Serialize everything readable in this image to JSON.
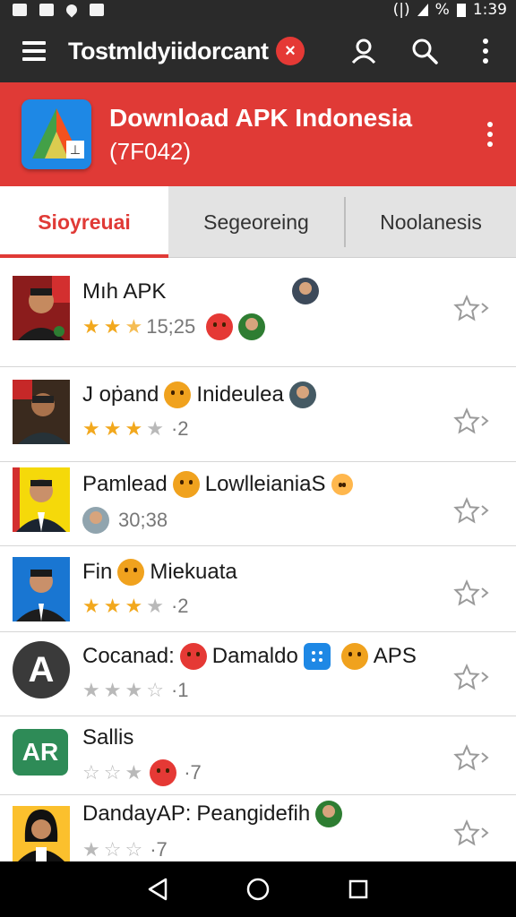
{
  "status_bar": {
    "time": "1:39",
    "battery": "%"
  },
  "app_bar": {
    "title": "Tostmldyiidorcant",
    "clear_icon": "×"
  },
  "header": {
    "title": "Download APK Indonesia",
    "subtitle": "(7F042)"
  },
  "tabs": [
    {
      "label": "Sioyreuai",
      "active": true
    },
    {
      "label": "Segeoreing",
      "active": false
    },
    {
      "label": "Noolanesis",
      "active": false
    }
  ],
  "apps": [
    {
      "title": "Mıh APK",
      "title_extra": "",
      "rating": 2.5,
      "meta": "15;25"
    },
    {
      "title": "J oṗand",
      "title_extra": "Inideulea",
      "rating": 3,
      "meta": "·2"
    },
    {
      "title": "Pamlead",
      "title_extra": "LowlleianiaS",
      "rating": 0,
      "meta": "30;38"
    },
    {
      "title": "Fin",
      "title_extra": "Miekuata",
      "rating": 3,
      "meta": "·2"
    },
    {
      "title": "Cocanad:",
      "title_extra": "Damaldo",
      "title_extra2": "APS",
      "rating": 0,
      "meta": "·1"
    },
    {
      "title": "Sallis",
      "title_extra": "",
      "rating": 0,
      "meta": "·7"
    },
    {
      "title": "DandayAP:",
      "title_extra": "Peangidefih",
      "rating": 0,
      "meta": "·7"
    }
  ],
  "thumb_text": {
    "app5": "A",
    "app6": "AR"
  },
  "colors": {
    "accent": "#e03a36",
    "star": "#f2a81d",
    "appbar": "#2b2b2b"
  },
  "icons": [
    "menu-icon",
    "close-icon",
    "user-icon",
    "search-icon",
    "more-vert-icon",
    "star-outline-icon",
    "chevron-right-icon",
    "back-icon",
    "home-icon",
    "recents-icon"
  ]
}
